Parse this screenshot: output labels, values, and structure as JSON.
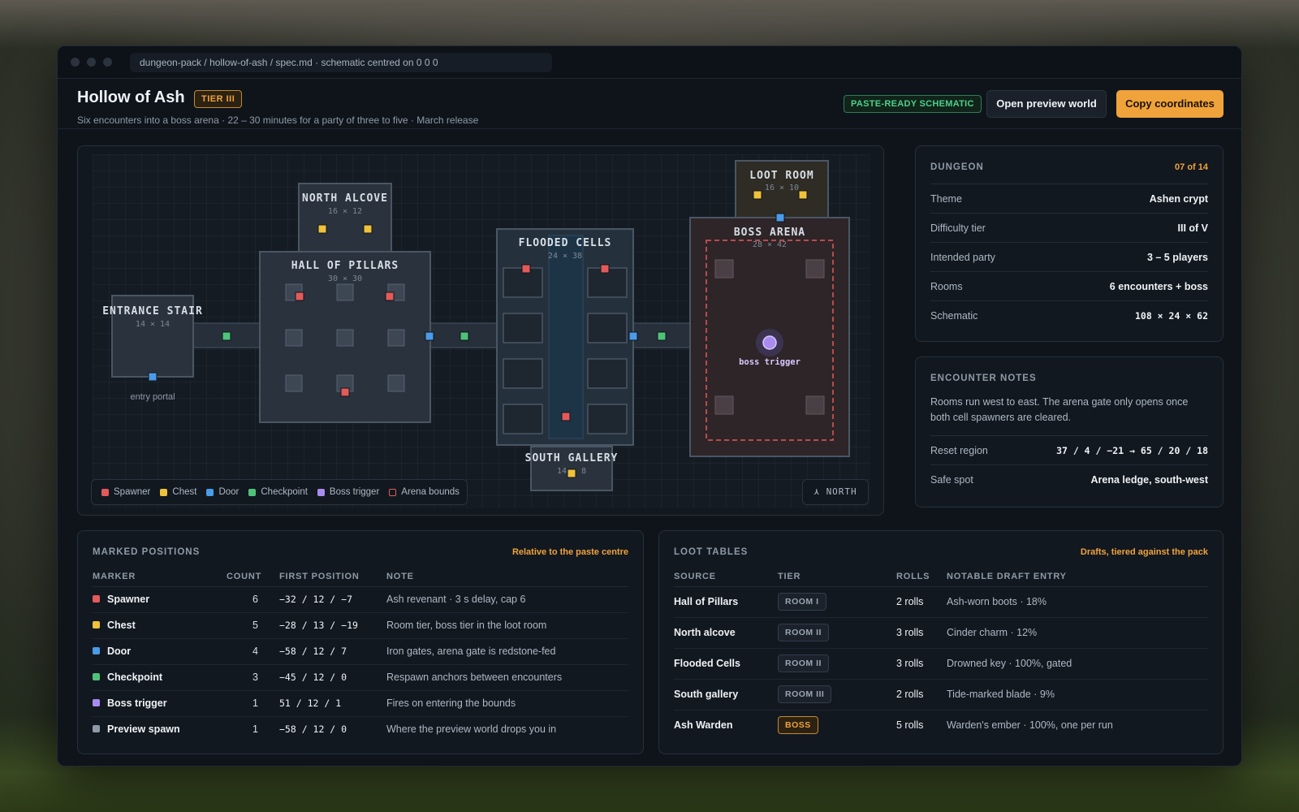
{
  "window": {
    "path": "dungeon-pack / hollow-of-ash / spec.md · schematic centred on 0 0 0"
  },
  "header": {
    "title": "Hollow of Ash",
    "tier_badge": "TIER III",
    "subtitle": "Six encounters into a boss arena · 22 – 30 minutes for a party of three to five · March release",
    "status_badge": "PASTE-READY SCHEMATIC",
    "preview_button": "Open preview world",
    "copy_button": "Copy coordinates"
  },
  "colors": {
    "spawner": "#e35a5a",
    "chest": "#f0c23a",
    "door": "#4a9be8",
    "checkpoint": "#4fc27a",
    "boss_trigger": "#a98bf0",
    "arena_bounds": "#e35a5a",
    "preview_spawn": "#8f9aa7",
    "accent": "#f0a33a"
  },
  "map": {
    "rooms": {
      "entrance": {
        "name": "ENTRANCE STAIR",
        "size": "14 × 14"
      },
      "north_alcove": {
        "name": "NORTH ALCOVE",
        "size": "16 × 12"
      },
      "hall": {
        "name": "HALL OF PILLARS",
        "size": "30 × 30"
      },
      "flooded": {
        "name": "FLOODED CELLS",
        "size": "24 × 38"
      },
      "south_gallery": {
        "name": "SOUTH GALLERY",
        "size": "14 × 8"
      },
      "loot_room": {
        "name": "LOOT ROOM",
        "size": "16 × 10"
      },
      "boss_arena": {
        "name": "BOSS ARENA",
        "size": "28 × 42"
      }
    },
    "entry_portal_label": "entry portal",
    "boss_trigger_label": "boss trigger",
    "legend": [
      "Spawner",
      "Chest",
      "Door",
      "Checkpoint",
      "Boss trigger",
      "Arena bounds"
    ],
    "north_label": "NORTH",
    "north_icon": "north-arrow-icon"
  },
  "dungeon": {
    "heading": "DUNGEON",
    "index": "07 of 14",
    "rows": [
      {
        "key": "Theme",
        "value": "Ashen crypt"
      },
      {
        "key": "Difficulty tier",
        "value": "III of V"
      },
      {
        "key": "Intended party",
        "value": "3 – 5 players"
      },
      {
        "key": "Rooms",
        "value": "6 encounters + boss"
      },
      {
        "key": "Schematic",
        "value": "108 × 24 × 62"
      }
    ]
  },
  "notes": {
    "heading": "ENCOUNTER NOTES",
    "text": "Rooms run west to east. The arena gate only opens once both cell spawners are cleared.",
    "rows": [
      {
        "key": "Reset region",
        "value": "37 / 4 / −21 → 65 / 20 / 18"
      },
      {
        "key": "Safe spot",
        "value": "Arena ledge, south-west"
      }
    ]
  },
  "marked": {
    "heading": "MARKED POSITIONS",
    "note": "Relative to the paste centre",
    "columns": [
      "MARKER",
      "COUNT",
      "FIRST POSITION",
      "NOTE"
    ],
    "rows": [
      {
        "marker": "Spawner",
        "count": "6",
        "pos": "−32 / 12 / −7",
        "note": "Ash revenant · 3 s delay, cap 6"
      },
      {
        "marker": "Chest",
        "count": "5",
        "pos": "−28 / 13 / −19",
        "note": "Room tier, boss tier in the loot room"
      },
      {
        "marker": "Door",
        "count": "4",
        "pos": "−58 / 12 / 7",
        "note": "Iron gates, arena gate is redstone-fed"
      },
      {
        "marker": "Checkpoint",
        "count": "3",
        "pos": "−45 / 12 / 0",
        "note": "Respawn anchors between encounters"
      },
      {
        "marker": "Boss trigger",
        "count": "1",
        "pos": "51 / 12 / 1",
        "note": "Fires on entering the bounds"
      },
      {
        "marker": "Preview spawn",
        "count": "1",
        "pos": "−58 / 12 / 0",
        "note": "Where the preview world drops you in"
      }
    ]
  },
  "loot": {
    "heading": "LOOT TABLES",
    "note": "Drafts, tiered against the pack",
    "columns": [
      "SOURCE",
      "TIER",
      "ROLLS",
      "NOTABLE DRAFT ENTRY"
    ],
    "rows": [
      {
        "source": "Hall of Pillars",
        "tier": "ROOM I",
        "rolls": "2 rolls",
        "entry": "Ash-worn boots · 18%"
      },
      {
        "source": "North alcove",
        "tier": "ROOM II",
        "rolls": "3 rolls",
        "entry": "Cinder charm · 12%"
      },
      {
        "source": "Flooded Cells",
        "tier": "ROOM II",
        "rolls": "3 rolls",
        "entry": "Drowned key · 100%, gated"
      },
      {
        "source": "South gallery",
        "tier": "ROOM III",
        "rolls": "2 rolls",
        "entry": "Tide-marked blade · 9%"
      },
      {
        "source": "Ash Warden",
        "tier": "BOSS",
        "rolls": "5 rolls",
        "entry": "Warden's ember · 100%, one per run"
      }
    ]
  }
}
